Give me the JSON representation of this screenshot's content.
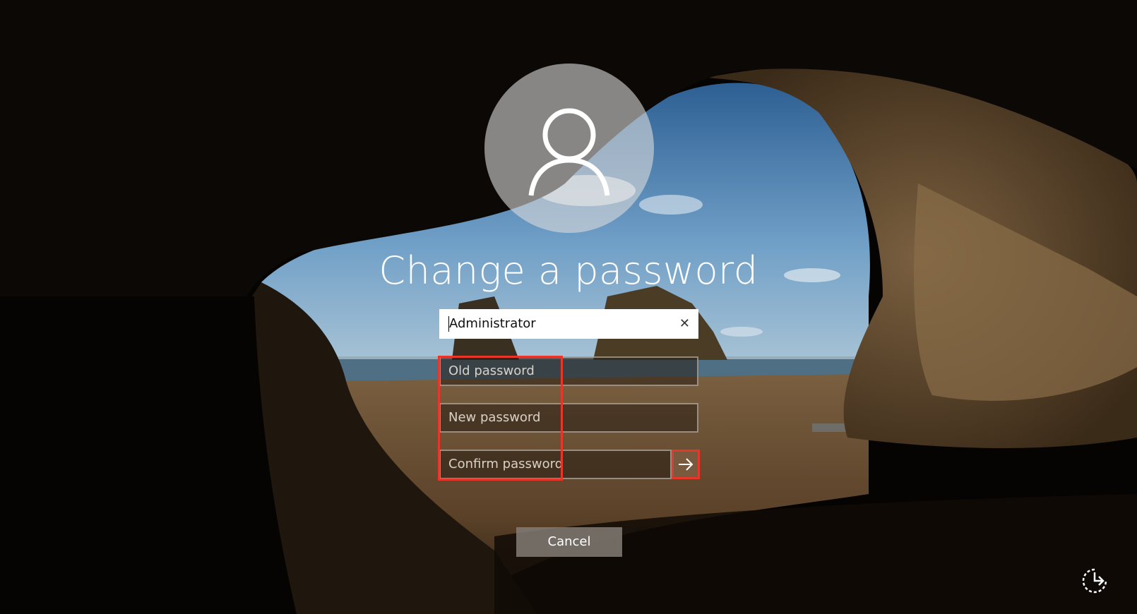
{
  "screen": {
    "title": "Change a password"
  },
  "form": {
    "username_value": "Administrator",
    "old_password_placeholder": "Old password",
    "new_password_placeholder": "New password",
    "confirm_password_placeholder": "Confirm password"
  },
  "actions": {
    "cancel_label": "Cancel"
  },
  "icons": {
    "avatar": "user-icon",
    "clear": "close-icon",
    "submit": "arrow-right-icon",
    "accessibility": "ease-of-access-icon"
  },
  "colors": {
    "highlight": "#e8362b",
    "text": "#ffffff"
  }
}
